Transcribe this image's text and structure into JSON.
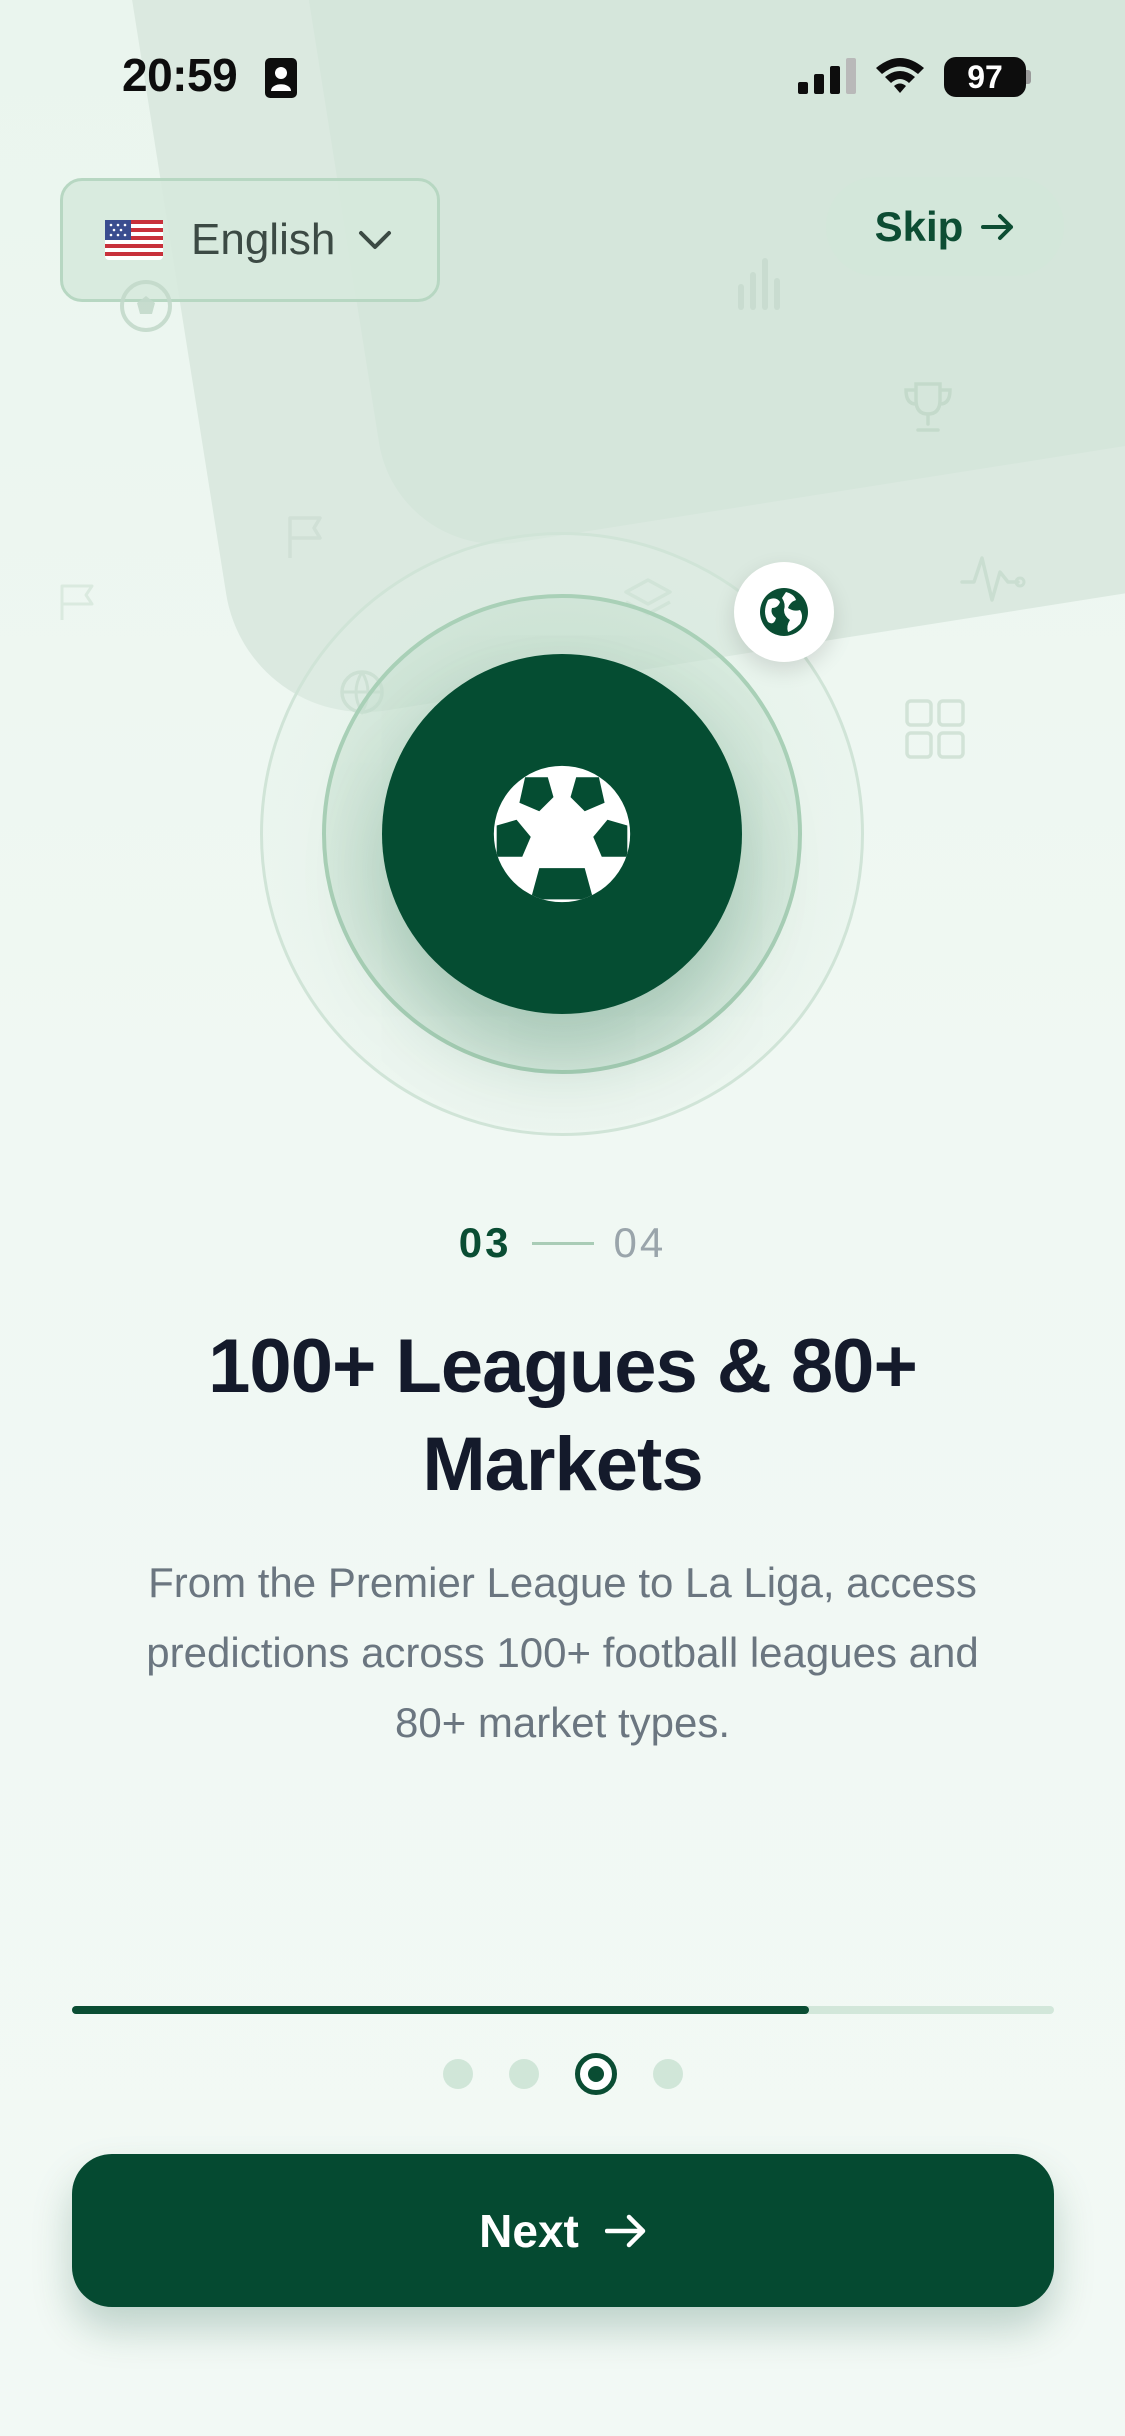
{
  "status_bar": {
    "time": "20:59",
    "battery": "97",
    "icons": [
      "id-card-icon",
      "signal-icon",
      "wifi-icon",
      "battery-icon"
    ]
  },
  "header": {
    "language": {
      "flag": "us-flag-icon",
      "label": "English",
      "icon": "chevron-down-icon"
    },
    "skip": {
      "label": "Skip",
      "icon": "arrow-right-icon"
    }
  },
  "hero": {
    "main_icon": "soccer-ball-icon",
    "badge_icon": "globe-icon",
    "decorative_icons": [
      "soccer-ball-icon",
      "bar-chart-icon",
      "trophy-icon",
      "flag-icon",
      "flag-icon",
      "layers-icon",
      "globe-icon",
      "pulse-icon",
      "grid-icon"
    ]
  },
  "step": {
    "current": "03",
    "total": "04"
  },
  "content": {
    "title": "100+ Leagues & 80+ Markets",
    "description": "From the Premier League to La Liga, access predictions across 100+ football leagues and 80+ market types."
  },
  "progress": {
    "fraction": 0.75,
    "dots": 4,
    "active_dot": 3
  },
  "footer": {
    "next_label": "Next",
    "next_icon": "arrow-right-icon"
  },
  "colors": {
    "primary": "#054d32",
    "background": "#eef7f1",
    "accent_light": "#d3e7da",
    "title": "#141a2b",
    "body_text": "#6b7680"
  }
}
